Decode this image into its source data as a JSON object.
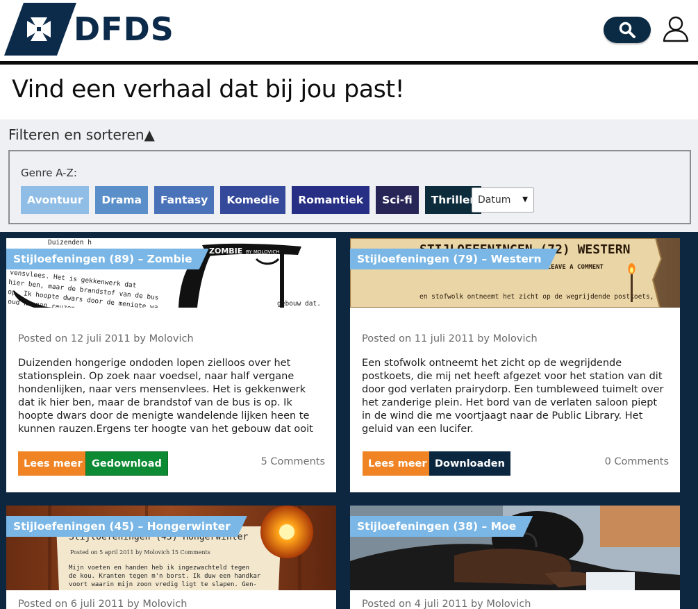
{
  "header": {
    "brand": "DFDS",
    "search_icon": "search-icon",
    "user_icon": "user-icon",
    "colors": {
      "brand_dark": "#0b2a44"
    }
  },
  "page": {
    "title": "Vind een verhaal dat bij jou past!"
  },
  "filter": {
    "toggle_label": "Filteren en sorteren▲",
    "genre_label": "Genre A-Z:",
    "genres": [
      {
        "label": "Avontuur",
        "color": "#8fbde6"
      },
      {
        "label": "Drama",
        "color": "#5b8fc9"
      },
      {
        "label": "Fantasy",
        "color": "#4a72b9"
      },
      {
        "label": "Komedie",
        "color": "#34499a"
      },
      {
        "label": "Romantiek",
        "color": "#262f83"
      },
      {
        "label": "Sci-fi",
        "color": "#262556"
      },
      {
        "label": "Thriller",
        "color": "#0c2c3c"
      }
    ],
    "sort": {
      "selected": "Datum"
    }
  },
  "cards": [
    {
      "tag": "Stijloefeningen (89) – Zombie",
      "meta": "Posted on 12 juli 2011 by Molovich",
      "excerpt": "Duizenden hongerige ondoden lopen zielloos over het stationsplein. Op zoek naar voedsel, naar half vergane hondenlijken, naar vers mensenvlees. Het is gekkenwerk dat ik hier ben, maar de brandstof van de bus is op. Ik hoopte dwars door de menigte wandelende lijken heen te kunnen rauzen.Ergens ter hoogte van het gebouw dat ooit",
      "read_label": "Lees meer",
      "download_label": "Gedownload",
      "comments": "5 Comments",
      "image": {
        "text_top": "Duizenden h",
        "title_text": "ZOMBIE",
        "byline": "BY MOLOVICH",
        "lines": [
          "vensvlees. Het is gekkenwerk dat",
          "hier ben, maar de brandstof van de bus",
          "op. Ik hoopte dwars door de menigte wa",
          "oud kunnen rauzen..."
        ],
        "side": "gebouw dat."
      }
    },
    {
      "tag": "Stijloefeningen (79) – Western",
      "meta": "Posted on 11 juli 2011 by Molovich",
      "excerpt": "Een stofwolk ontneemt het zicht op de wegrijdende postkoets, die mij net heeft afgezet voor het station van dit door god verlaten prairydorp. Een tumbleweed tuimelt over het zanderige plein. Het bord van de verlaten saloon piept in de wind die me voortjaagt naar de Public Library. Het geluid van een lucifer.",
      "read_label": "Lees meer",
      "download_label": "Downloaden",
      "comments": "0 Comments",
      "image": {
        "headline": "STIJLOEFENINGEN (72) WESTERN",
        "sub": "ICH LEAVE A COMMENT",
        "body": "en stofwolk ontneemt het zicht op de wegrijdende postkoets,"
      }
    },
    {
      "tag": "Stijloefeningen (45) – Hongerwinter",
      "meta": "Posted on 6 juli 2011 by Molovich",
      "image": {
        "heading": "Stijloefeningen (45) Hongerwinter",
        "posted": "Posted on 5 april 2011 by Molovich 15 Comments",
        "lines": [
          "Mijn voeten en handen heb ik ingezwachteld tegen",
          "de kou. Kranten tegen m'n borst. Ik duw een handkar",
          "voort waarin mijn zoon vredig ligt te slapen. Gen-"
        ]
      }
    },
    {
      "tag": "Stijloefeningen (38) – Moe",
      "meta": "Posted on 4 juli 2011 by Molovich"
    }
  ]
}
